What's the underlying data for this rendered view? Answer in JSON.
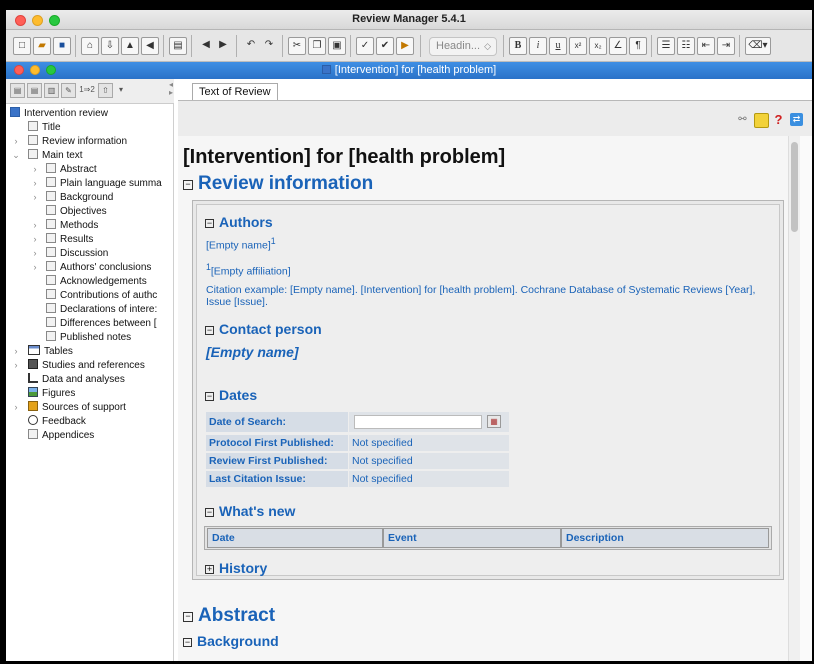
{
  "app": {
    "title": "Review Manager 5.4.1"
  },
  "toolbar": {
    "heading_style": "Headin...",
    "heading_arrow": "◇"
  },
  "document_window": {
    "title": "[Intervention] for [health problem]"
  },
  "sidebar": {
    "counter_label": "1⇒2",
    "tree": [
      {
        "label": "Intervention review"
      },
      {
        "label": "Title"
      },
      {
        "label": "Review information"
      },
      {
        "label": "Main text"
      },
      {
        "label": "Abstract"
      },
      {
        "label": "Plain language summa"
      },
      {
        "label": "Background"
      },
      {
        "label": "Objectives"
      },
      {
        "label": "Methods"
      },
      {
        "label": "Results"
      },
      {
        "label": "Discussion"
      },
      {
        "label": "Authors' conclusions"
      },
      {
        "label": "Acknowledgements"
      },
      {
        "label": "Contributions of authc"
      },
      {
        "label": "Declarations of intere:"
      },
      {
        "label": "Differences between ["
      },
      {
        "label": "Published notes"
      },
      {
        "label": "Tables"
      },
      {
        "label": "Studies and references"
      },
      {
        "label": "Data and analyses"
      },
      {
        "label": "Figures"
      },
      {
        "label": "Sources of support"
      },
      {
        "label": "Feedback"
      },
      {
        "label": "Appendices"
      }
    ]
  },
  "tabs": [
    {
      "label": "Text of Review"
    }
  ],
  "document": {
    "title": "[Intervention] for [health problem]",
    "review_information": "Review information",
    "authors_heading": "Authors",
    "author_name": "[Empty name]",
    "author_sup": "1",
    "affiliation_sup": "1",
    "affiliation": "[Empty affiliation]",
    "citation": "Citation example: [Empty name]. [Intervention] for [health problem]. Cochrane Database of Systematic Reviews [Year], Issue [Issue].",
    "contact_heading": "Contact person",
    "contact_name": "[Empty name]",
    "dates_heading": "Dates",
    "dates": [
      {
        "label": "Date of Search:",
        "value": ""
      },
      {
        "label": "Protocol First Published:",
        "value": "Not specified"
      },
      {
        "label": "Review First Published:",
        "value": "Not specified"
      },
      {
        "label": "Last Citation Issue:",
        "value": "Not specified"
      }
    ],
    "whats_new_heading": "What's new",
    "whats_new_columns": [
      "Date",
      "Event",
      "Description"
    ],
    "history_heading": "History",
    "abstract_heading": "Abstract",
    "background_heading": "Background"
  }
}
